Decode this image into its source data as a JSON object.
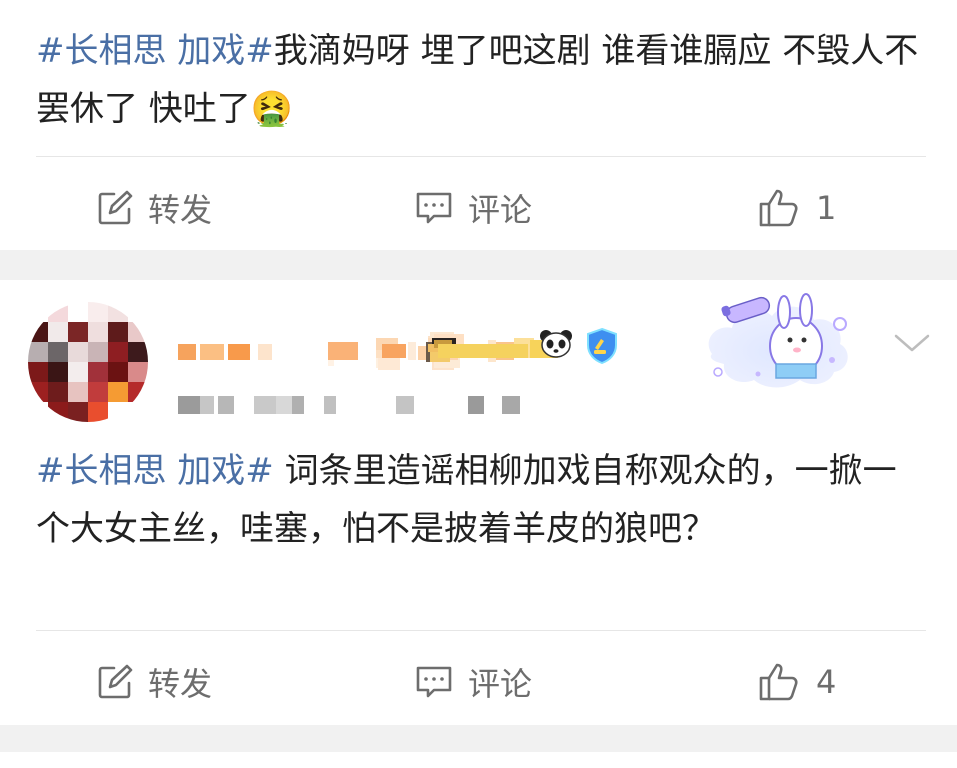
{
  "posts": [
    {
      "hashtag": "#长相思 加戏#",
      "text": "我滴妈呀 埋了吧这剧 谁看谁膈应 不毁人不罢休了 快吐了",
      "emoji": "🤮",
      "actions": {
        "repost_label": "转发",
        "comment_label": "评论",
        "like_count": "1"
      }
    },
    {
      "hashtag": "#长相思 加戏#",
      "text": " 词条里造谣相柳加戏自称观众的，一掀一个大女主丝，哇塞，怕不是披着羊皮的狼吧？",
      "actions": {
        "repost_label": "转发",
        "comment_label": "评论",
        "like_count": "4"
      }
    }
  ],
  "colors": {
    "hashtag": "#4a6fa5",
    "action_text": "#6d6d6d",
    "separator": "#f1f1f1",
    "divider": "#e6e6e6"
  },
  "icons": {
    "repost": "edit-square-icon",
    "comment": "comment-bubble-icon",
    "like": "thumbs-up-icon",
    "badge": "verified-badge-icon",
    "more": "chevron-down-icon"
  }
}
